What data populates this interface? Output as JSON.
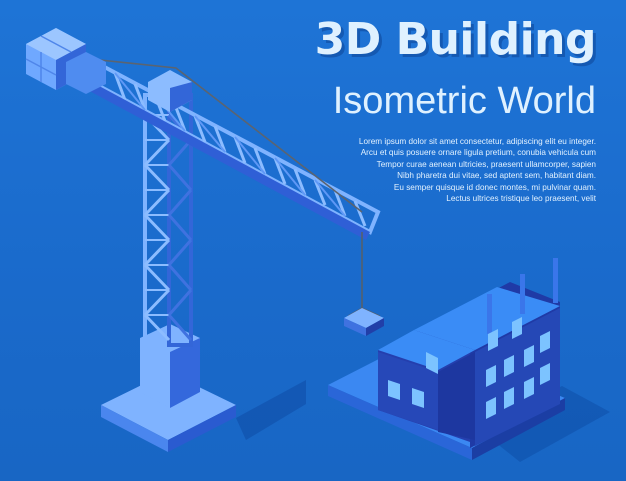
{
  "title": "3D Building",
  "subtitle": "Isometric World",
  "paragraph_lines": [
    "Lorem ipsum dolor sit amet consectetur, adipiscing elit eu integer.",
    "Arcu et quis posuere ornare ligula pretium, conubia vehicula cum",
    "Tempor curae aenean ultricies, praesent ullamcorper, sapien",
    "Nibh pharetra dui vitae, sed aptent sem, habitant diam.",
    "Eu semper quisque id donec montes, mi pulvinar quam.",
    "Lectus ultrices tristique leo praesent, velit"
  ],
  "colors": {
    "background": "#1b6fd0",
    "text": "#dff1ff",
    "crane_light": "#6fa8ff",
    "crane_dark": "#2f5fd6",
    "building_top": "#2f7df0",
    "building_side": "#1f3da8"
  }
}
